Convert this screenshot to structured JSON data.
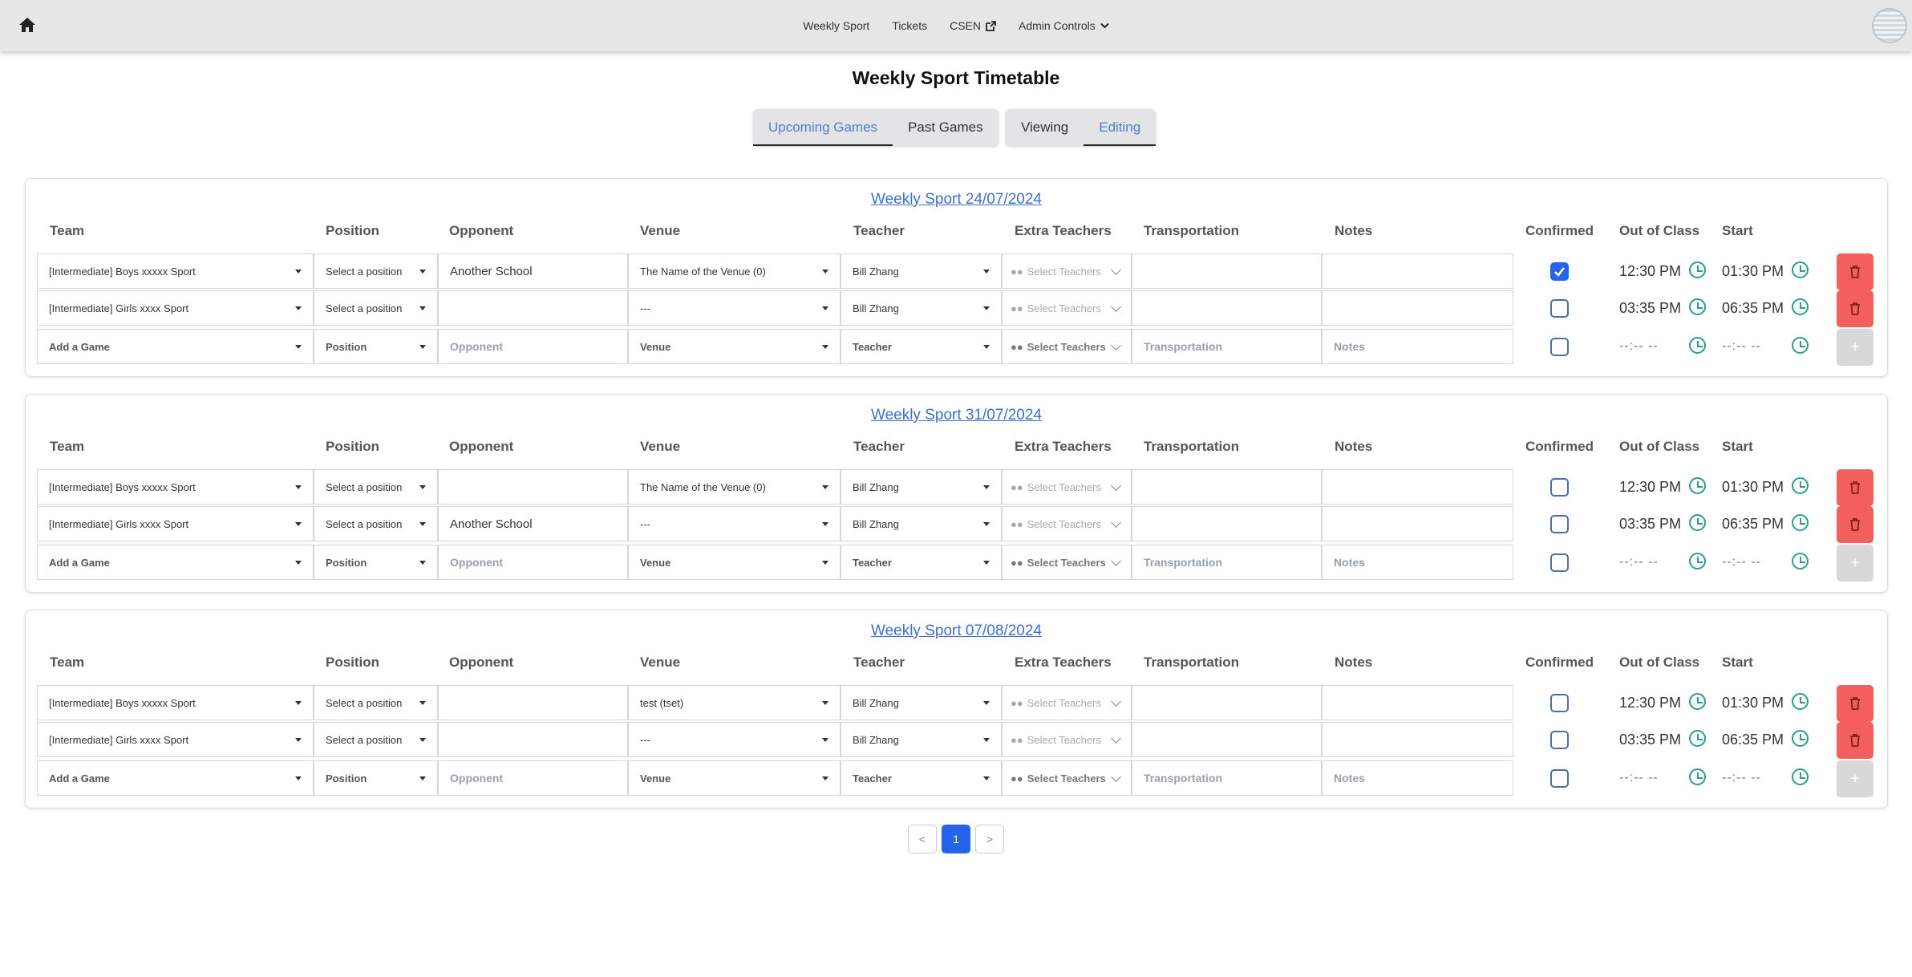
{
  "nav": {
    "items": [
      "Weekly Sport",
      "Tickets",
      "CSEN",
      "Admin Controls"
    ]
  },
  "page_title": "Weekly Sport Timetable",
  "games_tabs": [
    "Upcoming Games",
    "Past Games"
  ],
  "mode_tabs": [
    "Viewing",
    "Editing"
  ],
  "headers": {
    "team": "Team",
    "position": "Position",
    "opponent": "Opponent",
    "venue": "Venue",
    "teacher": "Teacher",
    "extra": "Extra Teachers",
    "transport": "Transportation",
    "notes": "Notes",
    "confirmed": "Confirmed",
    "out": "Out of Class",
    "start": "Start"
  },
  "add_row": {
    "team": "Add a Game",
    "position": "Position",
    "opponent": "Opponent",
    "venue": "Venue",
    "teacher": "Teacher",
    "extra": "Select Teachers",
    "transport": "Transportation",
    "notes": "Notes",
    "time_blank": "--:-- --",
    "add": "+"
  },
  "extra_placeholder": "Select Teachers",
  "weeks": [
    {
      "title": "Weekly Sport 24/07/2024",
      "rows": [
        {
          "team": "[Intermediate] Boys xxxxx Sport",
          "position": "Select a position",
          "opponent": "Another School",
          "venue": "The Name of the Venue (0)",
          "teacher": "Bill Zhang",
          "confirmed": true,
          "out": "12:30 PM",
          "start": "01:30 PM"
        },
        {
          "team": "[Intermediate] Girls xxxx Sport",
          "position": "Select a position",
          "opponent": "",
          "venue": "---",
          "teacher": "Bill Zhang",
          "confirmed": false,
          "out": "03:35 PM",
          "start": "06:35 PM"
        }
      ]
    },
    {
      "title": "Weekly Sport 31/07/2024",
      "rows": [
        {
          "team": "[Intermediate] Boys xxxxx Sport",
          "position": "Select a position",
          "opponent": "",
          "venue": "The Name of the Venue (0)",
          "teacher": "Bill Zhang",
          "confirmed": false,
          "out": "12:30 PM",
          "start": "01:30 PM"
        },
        {
          "team": "[Intermediate] Girls xxxx Sport",
          "position": "Select a position",
          "opponent": "Another School",
          "venue": "---",
          "teacher": "Bill Zhang",
          "confirmed": false,
          "out": "03:35 PM",
          "start": "06:35 PM"
        }
      ]
    },
    {
      "title": "Weekly Sport 07/08/2024",
      "rows": [
        {
          "team": "[Intermediate] Boys xxxxx Sport",
          "position": "Select a position",
          "opponent": "",
          "venue": "test (tset)",
          "teacher": "Bill Zhang",
          "confirmed": false,
          "out": "12:30 PM",
          "start": "01:30 PM"
        },
        {
          "team": "[Intermediate] Girls xxxx Sport",
          "position": "Select a position",
          "opponent": "",
          "venue": "---",
          "teacher": "Bill Zhang",
          "confirmed": false,
          "out": "03:35 PM",
          "start": "06:35 PM"
        }
      ]
    }
  ],
  "pagination": {
    "prev": "<",
    "current": "1",
    "next": ">"
  },
  "colors": {
    "accent": "#2563eb",
    "danger": "#f25f5c",
    "clock": "#2a9d8f",
    "link": "#3f6fd0"
  }
}
